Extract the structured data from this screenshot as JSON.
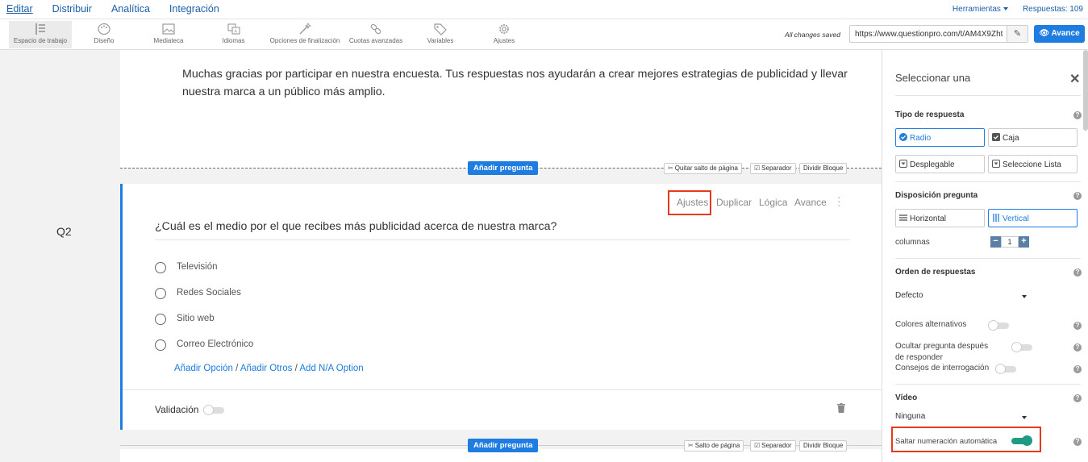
{
  "topnav": {
    "menu": [
      "Editar",
      "Distribuir",
      "Analítica",
      "Integración"
    ],
    "herramientas": "Herramientas",
    "respuestas": "Respuestas: 109"
  },
  "toolbar": {
    "tools": [
      {
        "label": "Espacio de trabajo",
        "icon": "workspace-icon"
      },
      {
        "label": "Diseño",
        "icon": "palette-icon"
      },
      {
        "label": "Mediateca",
        "icon": "image-icon"
      },
      {
        "label": "Idiomas",
        "icon": "language-icon"
      },
      {
        "label": "Opciones de finalización",
        "icon": "wand-icon"
      },
      {
        "label": "Cuotas avanzadas",
        "icon": "link-icon"
      },
      {
        "label": "Variables",
        "icon": "tag-icon"
      },
      {
        "label": "Ajustes",
        "icon": "gear-icon"
      }
    ],
    "saved": "All changes saved",
    "url": "https://www.questionpro.com/t/AM4X9Zht",
    "avance": "Avance"
  },
  "intro": {
    "text": "Muchas gracias por participar en nuestra encuesta. Tus respuestas nos ayudarán a crear mejores estrategias de publicidad y llevar nuestra marca a un público más amplio."
  },
  "separator1": {
    "add": "Añadir pregunta",
    "quitar": "Quitar salto de página",
    "separador": "Separador",
    "dividir": "Dividir Bloque"
  },
  "question": {
    "number": "Q2",
    "actions": {
      "ajustes": "Ajustes",
      "duplicar": "Duplicar",
      "logica": "Lógica",
      "avance": "Avance"
    },
    "title": "¿Cuál es el medio por el que recibes más publicidad acerca de nuestra marca?",
    "options": [
      "Televisión",
      "Redes Sociales",
      "Sitio web",
      "Correo Electrónico"
    ],
    "add_links": {
      "opcion": "Añadir Opción",
      "otros": "Añadir Otros",
      "na": "Add N/A Option",
      "slash": "/"
    },
    "validacion": "Validación"
  },
  "separator2": {
    "add": "Añadir pregunta",
    "salto": "Salto de página",
    "separador": "Separador",
    "dividir": "Dividir Bloque"
  },
  "panel": {
    "title": "Seleccionar una",
    "tipo_respuesta": "Tipo de respuesta",
    "tipos": {
      "radio": "Radio",
      "caja": "Caja",
      "desplegable": "Desplegable",
      "lista": "Seleccione Lista"
    },
    "disposicion": "Disposición pregunta",
    "disp": {
      "horizontal": "Horizontal",
      "vertical": "Vertical"
    },
    "columnas": "columnas",
    "columnas_value": "1",
    "orden": "Orden de respuestas",
    "orden_value": "Defecto",
    "colores": "Colores alternativos",
    "ocultar": "Ocultar pregunta después de responder",
    "consejos": "Consejos de interrogación",
    "video": "Vídeo",
    "video_value": "Ninguna",
    "saltar": "Saltar numeración automática"
  },
  "colors": {
    "accent": "#1f7ce0",
    "toggle_on": "#1e9b85",
    "highlight": "#e63a1f"
  }
}
